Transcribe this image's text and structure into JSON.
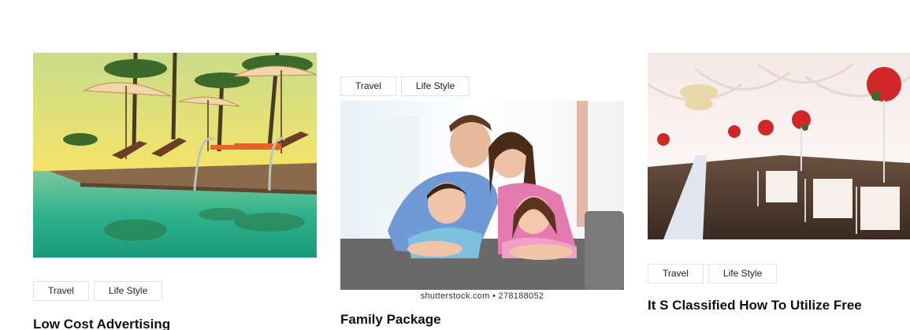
{
  "posts": [
    {
      "title": "Low Cost Advertising",
      "tags": [
        "Travel",
        "Life Style"
      ],
      "image": "resort-pool-palm-trees"
    },
    {
      "title": "Family Package",
      "tags": [
        "Travel",
        "Life Style"
      ],
      "image": "family-on-sofa",
      "credit": "shutterstock.com • 278188052"
    },
    {
      "title": "It S Classified How To Utilize Free",
      "tags": [
        "Travel",
        "Life Style"
      ],
      "image": "wedding-banquet-hall"
    }
  ]
}
